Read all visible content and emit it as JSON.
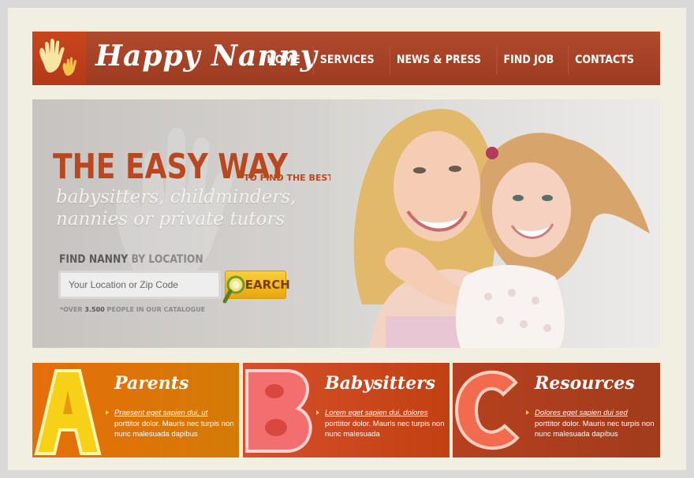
{
  "brand": {
    "name": "Happy Nanny"
  },
  "nav": [
    {
      "label": "HOME"
    },
    {
      "label": "SERVICES"
    },
    {
      "label": "NEWS & PRESS"
    },
    {
      "label": "FIND JOB"
    },
    {
      "label": "CONTACTS"
    }
  ],
  "hero": {
    "title_big": "THE EASY WAY",
    "title_small": "TO FIND THE BEST",
    "script_line1": "babysitters, childminders,",
    "script_line2": "nannies or private tutors",
    "find_bold": "FIND NANNY",
    "find_light": "BY LOCATION",
    "search_placeholder": "Your Location or Zip Code",
    "search_button": "SEARCH",
    "catalog_prefix": "*OVER",
    "catalog_count": "3.500",
    "catalog_suffix": "PEOPLE IN OUR CATALOGUE"
  },
  "features": [
    {
      "letter": "A",
      "title": "Parents",
      "link": "Praesent eget sapien dui, ut",
      "text": "porttitor dolor. Mauris nec turpis non nunc malesuada dapibus"
    },
    {
      "letter": "B",
      "title": "Babysitters",
      "link": "Lorem eget sapien dui, dolores",
      "text": "porttitor dolor. Mauris nec turpis non nunc malesuada"
    },
    {
      "letter": "C",
      "title": "Resources",
      "link": "Dolores eget sapien dui sed",
      "text": "porttitor dolor. Mauris nec turpis non nunc malesuada dapibus"
    }
  ],
  "colors": {
    "header_bg": "#a9442a",
    "accent_orange": "#e66e0a",
    "accent_red": "#c24012",
    "accent_brown": "#a13c1c",
    "search_yellow": "#f2bb22"
  }
}
